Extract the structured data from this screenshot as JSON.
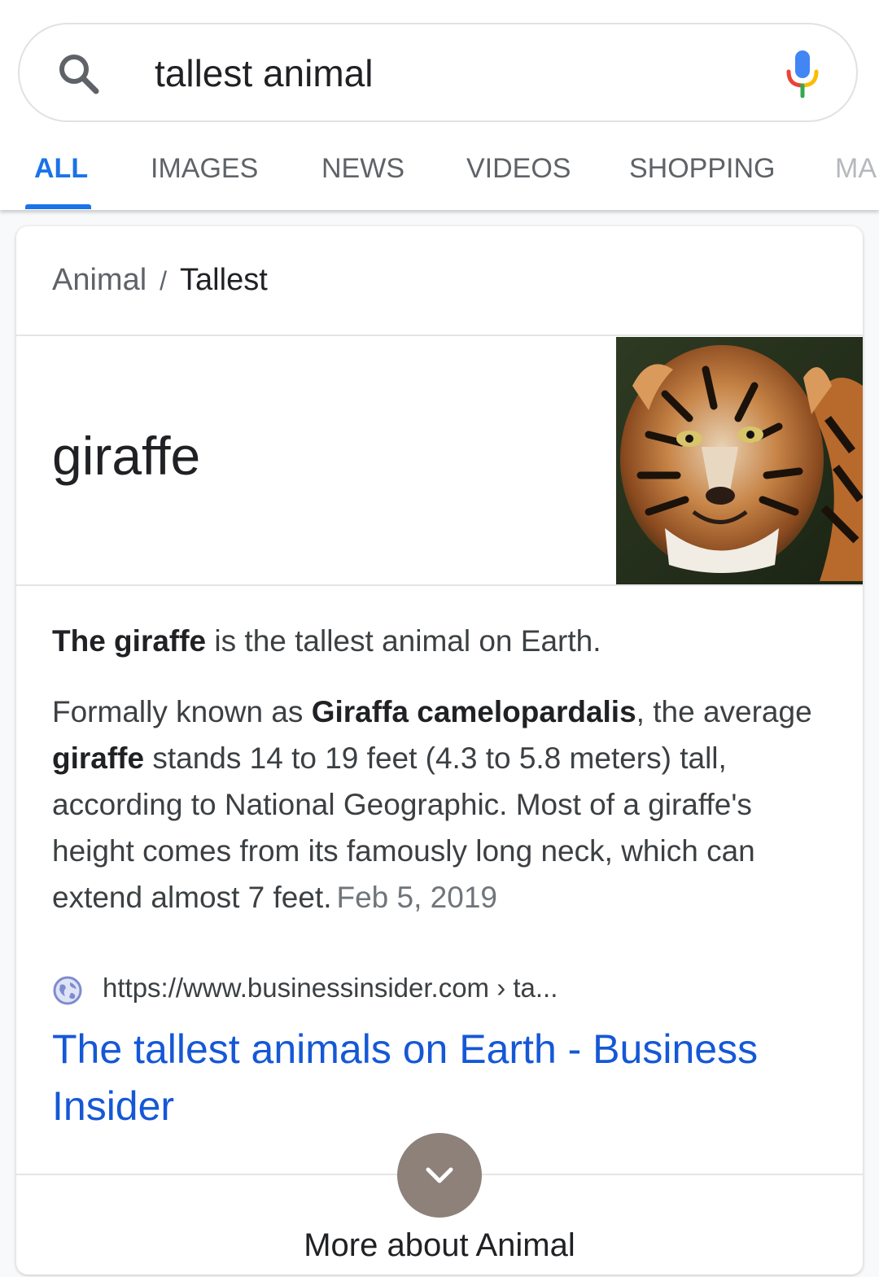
{
  "search": {
    "query": "tallest animal"
  },
  "tabs": [
    {
      "label": "ALL",
      "active": true
    },
    {
      "label": "IMAGES",
      "active": false
    },
    {
      "label": "NEWS",
      "active": false
    },
    {
      "label": "VIDEOS",
      "active": false
    },
    {
      "label": "SHOPPING",
      "active": false
    },
    {
      "label": "MA",
      "active": false
    }
  ],
  "card": {
    "breadcrumb": {
      "parent": "Animal",
      "separator": "/",
      "current": "Tallest"
    },
    "answer": "giraffe",
    "image_subject": "tiger",
    "snippet": {
      "lead_bold": "The giraffe",
      "lead_rest": " is the tallest animal on Earth.",
      "body_1": "Formally known as ",
      "body_bold_1": "Giraffa camelopardalis",
      "body_2": ", the average ",
      "body_bold_2": "giraffe",
      "body_3": " stands 14 to 19 feet (4.3 to 5.8 meters) tall, according to National Geographic. Most of a giraffe's height comes from its famously long neck, which can extend almost 7 feet.",
      "date": "Feb 5, 2019"
    },
    "source_url": "https://www.businessinsider.com › ta...",
    "result_title": "The tallest animals on Earth - Business Insider",
    "more_label": "More about Animal"
  },
  "colors": {
    "accent": "#1a73e8",
    "link": "#1558d6",
    "expand_button": "#8d8179"
  },
  "icons": [
    "search-icon",
    "mic-icon",
    "globe-icon",
    "chevron-down-icon"
  ]
}
